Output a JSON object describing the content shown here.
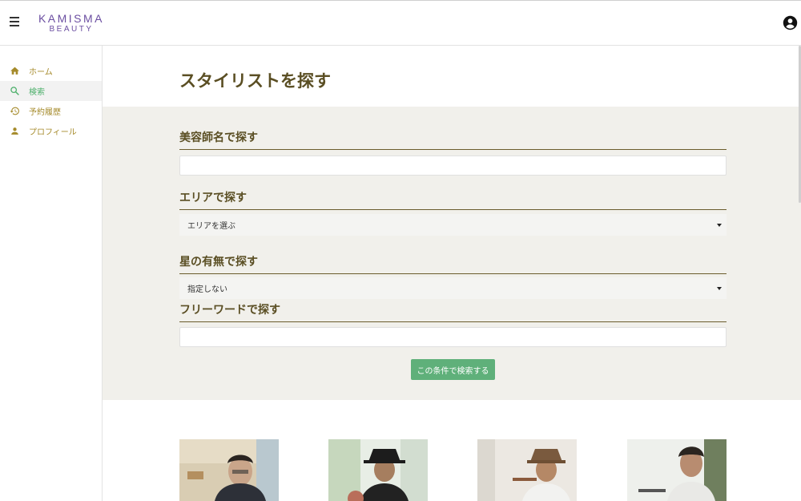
{
  "header": {
    "logo_line1": "KAMISMA",
    "logo_line2": "BEAUTY",
    "menu_icon": "hamburger-menu-icon",
    "account_icon": "account-circle-icon"
  },
  "sidebar": {
    "items": [
      {
        "label": "ホーム",
        "icon": "home-icon",
        "active": false
      },
      {
        "label": "検索",
        "icon": "search-icon",
        "active": true
      },
      {
        "label": "予約履歴",
        "icon": "history-icon",
        "active": false
      },
      {
        "label": "プロフィール",
        "icon": "person-icon",
        "active": false
      }
    ]
  },
  "main": {
    "title": "スタイリストを探す",
    "sections": {
      "name": {
        "label": "美容師名で探す",
        "value": ""
      },
      "area": {
        "label": "エリアで探す",
        "selected": "エリアを選ぶ"
      },
      "stars": {
        "label": "星の有無で探す",
        "selected": "指定しない"
      },
      "keyword": {
        "label": "フリーワードで探す",
        "value": ""
      }
    },
    "search_button": "この条件で検索する",
    "stylist_cards": [
      "stylist-photo-1",
      "stylist-photo-2",
      "stylist-photo-3",
      "stylist-photo-4"
    ]
  },
  "colors": {
    "accent_green": "#5fb07a",
    "nav_gold": "#a58a2a",
    "heading_brown": "#5a4e23",
    "logo_purple": "#6b4ea1",
    "panel_bg": "#f1f0eb"
  }
}
